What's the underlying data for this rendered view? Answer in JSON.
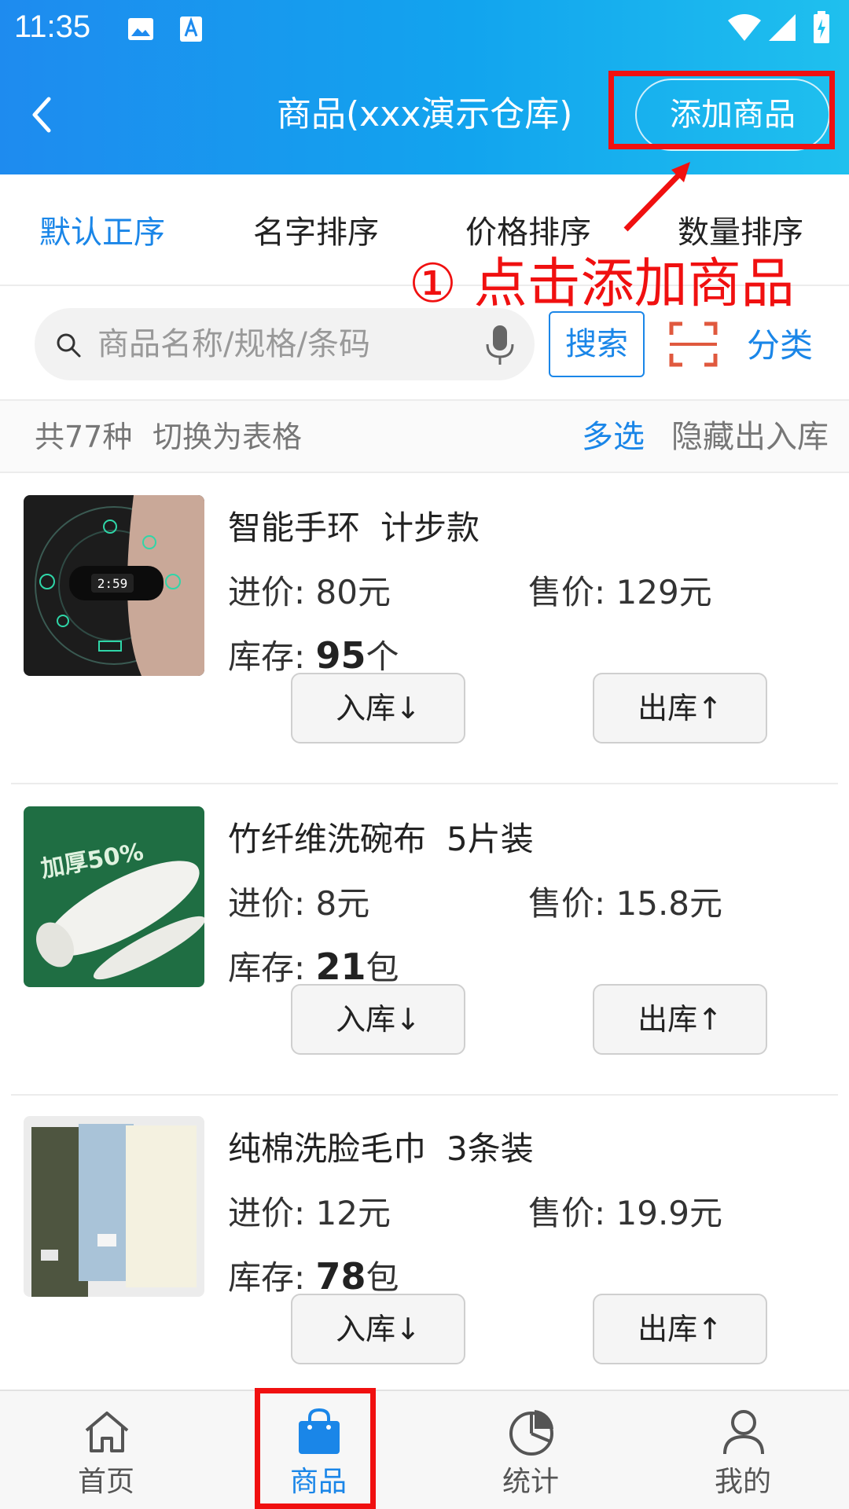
{
  "status_bar": {
    "time": "11:35"
  },
  "header": {
    "title": "商品(xxx演示仓库)",
    "add_button": "添加商品"
  },
  "sort_tabs": [
    {
      "label": "默认正序",
      "active": true
    },
    {
      "label": "名字排序",
      "active": false
    },
    {
      "label": "价格排序",
      "active": false
    },
    {
      "label": "数量排序",
      "active": false
    }
  ],
  "annotation": {
    "text": "① 点击添加商品",
    "color": "#f01010"
  },
  "search": {
    "placeholder": "商品名称/规格/条码",
    "button": "搜索",
    "category": "分类"
  },
  "summary": {
    "total": "共77种",
    "switch_table": "切换为表格",
    "multi_select": "多选",
    "hide_io": "隐藏出入库"
  },
  "labels": {
    "purchase_price": "进价:",
    "sale_price": "售价:",
    "stock": "库存:",
    "stock_in": "入库↓",
    "stock_out": "出库↑"
  },
  "products": [
    {
      "name": "智能手环",
      "spec": "计步款",
      "purchase_price": "80元",
      "sale_price": "129元",
      "stock_num": "95",
      "stock_unit": "个",
      "thumb_text": ""
    },
    {
      "name": "竹纤维洗碗布",
      "spec": "5片装",
      "purchase_price": "8元",
      "sale_price": "15.8元",
      "stock_num": "21",
      "stock_unit": "包",
      "thumb_text": "加厚50%"
    },
    {
      "name": "纯棉洗脸毛巾",
      "spec": "3条装",
      "purchase_price": "12元",
      "sale_price": "19.9元",
      "stock_num": "78",
      "stock_unit": "包",
      "thumb_text": ""
    }
  ],
  "bottom_nav": [
    {
      "label": "首页",
      "icon": "home-icon",
      "active": false
    },
    {
      "label": "商品",
      "icon": "shopping-bag-icon",
      "active": true
    },
    {
      "label": "统计",
      "icon": "pie-chart-icon",
      "active": false
    },
    {
      "label": "我的",
      "icon": "user-icon",
      "active": false
    }
  ],
  "colors": {
    "accent": "#1a86e8",
    "header_start": "#1e8bef",
    "header_end": "#1fc0ee",
    "highlight": "#f01010"
  }
}
